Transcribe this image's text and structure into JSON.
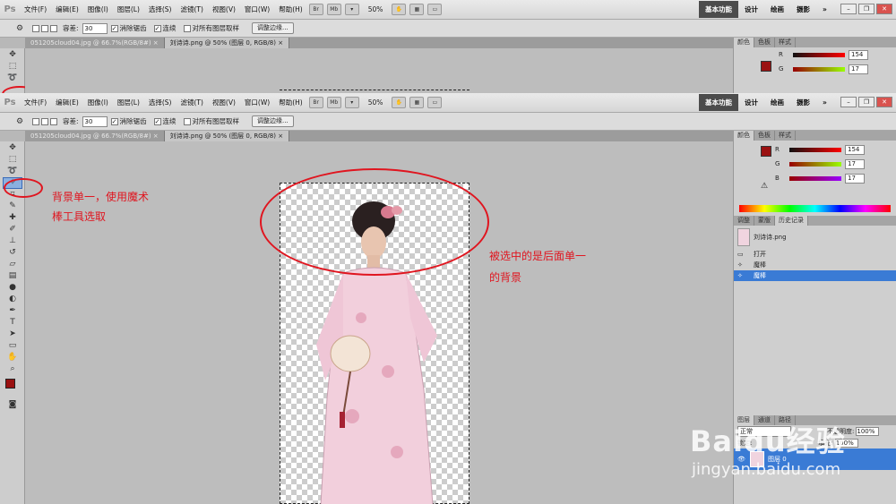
{
  "app": {
    "logo": "Ps"
  },
  "menu": [
    "文件(F)",
    "编辑(E)",
    "图像(I)",
    "图层(L)",
    "选择(S)",
    "滤镜(T)",
    "视图(V)",
    "窗口(W)",
    "帮助(H)"
  ],
  "menubar_buttons": [
    "Br",
    "Mb"
  ],
  "zoom_level": "50%",
  "workspace": {
    "active": "基本功能",
    "items": [
      "设计",
      "绘画",
      "摄影"
    ],
    "more": "»"
  },
  "options": {
    "tolerance_label": "容差:",
    "tolerance_value": "30",
    "antialias": "消除锯齿",
    "contiguous": "连续",
    "sample_all": "对所有图层取样",
    "refine_edge": "调整边缘..."
  },
  "tabs": [
    "051205cloud04.jpg @ 66.7%(RGB/8#)",
    "刘诗诗.png @ 50% (图层 0, RGB/8)"
  ],
  "tab_close": "×",
  "color_panel": {
    "tabs": [
      "颜色",
      "色板",
      "样式"
    ],
    "sliders": [
      {
        "label": "R",
        "value": "154",
        "color": "#ff0000"
      },
      {
        "label": "G",
        "value": "17",
        "color": "#00c000"
      },
      {
        "label": "B",
        "value": "17",
        "color": "#2040ff"
      }
    ],
    "warning_glyph": "⚠"
  },
  "history_panel": {
    "tabs": [
      "调整",
      "蒙版",
      "历史记录"
    ],
    "snapshot": "刘诗诗.png",
    "items": [
      {
        "label": "打开",
        "selected": false
      },
      {
        "label": "魔棒",
        "selected": false
      },
      {
        "label": "魔棒",
        "selected": true
      }
    ]
  },
  "layers_panel": {
    "tabs": [
      "图层",
      "通道",
      "路径"
    ],
    "blend_mode": "正常",
    "opacity_label": "不透明度:",
    "opacity": "100%",
    "lock_label": "锁定:",
    "fill_label": "填充:",
    "fill": "100%",
    "layer_name": "图层 0"
  },
  "annotations": {
    "left_line1": "背景单一，使用魔术",
    "left_line2": "棒工具选取",
    "right_line1": "被选中的是后面单一",
    "right_line2": "的背景"
  },
  "watermark": {
    "main": "Baidu经验",
    "sub": "jingyan.baidu.com"
  },
  "colors": {
    "annotation": "#e0151f",
    "selection": "#3a7bd5",
    "foreground": "#9a1111"
  }
}
